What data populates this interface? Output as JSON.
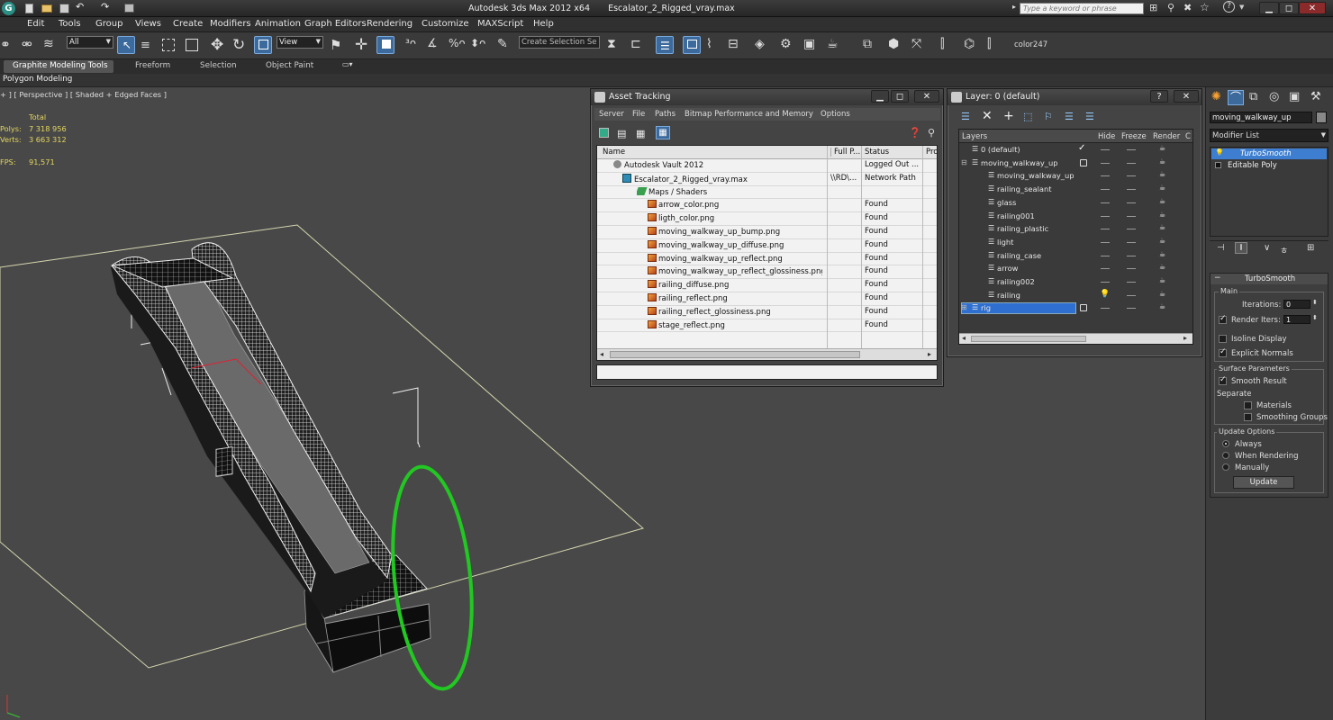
{
  "titlebar": {
    "app": "Autodesk 3ds Max  2012 x64",
    "file": "Escalator_2_Rigged_vray.max",
    "search_placeholder": "Type a keyword or phrase"
  },
  "menu": [
    "Edit",
    "Tools",
    "Group",
    "Views",
    "Create",
    "Modifiers",
    "Animation",
    "Graph Editors",
    "Rendering",
    "Customize",
    "MAXScript",
    "Help"
  ],
  "toolbar": {
    "selection_filter": "All",
    "ref_coord": "View",
    "selection_set_placeholder": "Create Selection Se",
    "color_label": "color247"
  },
  "ribbon": {
    "tabs": [
      "Graphite Modeling Tools",
      "Freeform",
      "Selection",
      "Object Paint"
    ],
    "panel": "Polygon Modeling"
  },
  "viewport": {
    "label": "+ ] [ Perspective ] [ Shaded + Edged Faces ]",
    "stats": {
      "total_label": "Total",
      "polys_label": "Polys:",
      "polys": "7 318 956",
      "verts_label": "Verts:",
      "verts": "3 663 312",
      "fps_label": "FPS:",
      "fps": "91,571"
    }
  },
  "asset_tracking": {
    "title": "Asset Tracking",
    "menu": [
      "Server",
      "File",
      "Paths",
      "Bitmap Performance and Memory",
      "Options"
    ],
    "columns": [
      "Name",
      "Full P...",
      "Status",
      "Pro"
    ],
    "rows": [
      {
        "name": "Autodesk Vault 2012",
        "path": "",
        "status": "Logged Out ...",
        "indent": 0,
        "icon": "vault"
      },
      {
        "name": "Escalator_2_Rigged_vray.max",
        "path": "\\\\RD\\...",
        "status": "Network Path",
        "indent": 1,
        "icon": "max"
      },
      {
        "name": "Maps / Shaders",
        "path": "",
        "status": "",
        "indent": 2,
        "icon": "maps"
      },
      {
        "name": "arrow_color.png",
        "path": "",
        "status": "Found",
        "indent": 3,
        "icon": "png"
      },
      {
        "name": "ligth_color.png",
        "path": "",
        "status": "Found",
        "indent": 3,
        "icon": "png"
      },
      {
        "name": "moving_walkway_up_bump.png",
        "path": "",
        "status": "Found",
        "indent": 3,
        "icon": "png"
      },
      {
        "name": "moving_walkway_up_diffuse.png",
        "path": "",
        "status": "Found",
        "indent": 3,
        "icon": "png"
      },
      {
        "name": "moving_walkway_up_reflect.png",
        "path": "",
        "status": "Found",
        "indent": 3,
        "icon": "png"
      },
      {
        "name": "moving_walkway_up_reflect_glossiness.png",
        "path": "",
        "status": "Found",
        "indent": 3,
        "icon": "png"
      },
      {
        "name": "railing_diffuse.png",
        "path": "",
        "status": "Found",
        "indent": 3,
        "icon": "png"
      },
      {
        "name": "railing_reflect.png",
        "path": "",
        "status": "Found",
        "indent": 3,
        "icon": "png"
      },
      {
        "name": "railing_reflect_glossiness.png",
        "path": "",
        "status": "Found",
        "indent": 3,
        "icon": "png"
      },
      {
        "name": "stage_reflect.png",
        "path": "",
        "status": "Found",
        "indent": 3,
        "icon": "png"
      }
    ]
  },
  "layer_dialog": {
    "title": "Layer: 0 (default)",
    "columns": [
      "Layers",
      "Hide",
      "Freeze",
      "Render",
      "C"
    ],
    "rows": [
      {
        "name": "0 (default)",
        "indent": 0,
        "current": true
      },
      {
        "name": "moving_walkway_up",
        "indent": 0,
        "expand": "-"
      },
      {
        "name": "moving_walkway_up",
        "indent": 1
      },
      {
        "name": "railing_sealant",
        "indent": 1
      },
      {
        "name": "glass",
        "indent": 1
      },
      {
        "name": "railing001",
        "indent": 1
      },
      {
        "name": "railing_plastic",
        "indent": 1
      },
      {
        "name": "light",
        "indent": 1
      },
      {
        "name": "railing_case",
        "indent": 1
      },
      {
        "name": "arrow",
        "indent": 1
      },
      {
        "name": "railing002",
        "indent": 1
      },
      {
        "name": "railing",
        "indent": 1,
        "bulb": true
      },
      {
        "name": "rig",
        "indent": 0,
        "expand": "+",
        "selected": true
      }
    ]
  },
  "command_panel": {
    "object_name": "moving_walkway_up",
    "modifier_list_label": "Modifier List",
    "stack": [
      "TurboSmooth",
      "Editable Poly"
    ],
    "rollout_title": "TurboSmooth",
    "main_group": "Main",
    "iterations_label": "Iterations:",
    "iterations": "0",
    "render_iters_label": "Render Iters:",
    "render_iters": "1",
    "isoline": "Isoline Display",
    "explicit_normals": "Explicit Normals",
    "surface_group": "Surface Parameters",
    "smooth_result": "Smooth Result",
    "separate_label": "Separate",
    "materials": "Materials",
    "smoothing_groups": "Smoothing Groups",
    "update_group": "Update Options",
    "update_always": "Always",
    "update_rendering": "When Rendering",
    "update_manually": "Manually",
    "update_button": "Update"
  }
}
